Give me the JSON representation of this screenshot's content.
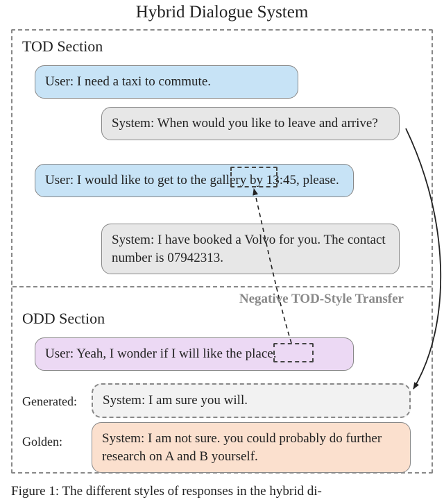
{
  "title": "Hybrid Dialogue System",
  "tod": {
    "label": "TOD Section",
    "user1": "User: I need a taxi to commute.",
    "sys1": "System: When would you like to leave and arrive?",
    "user2": "User: I would like to get to the gallery by 13:45, please.",
    "sys2": "System: I have booked a Volvo for you. The contact number is 07942313."
  },
  "transfer_label": "Negative TOD-Style Transfer",
  "odd": {
    "label": "ODD Section",
    "user1": "User: Yeah, I wonder if I will like the place.",
    "generated_label": "Generated:",
    "generated": "System: I am sure you will.",
    "golden_label": "Golden:",
    "golden": "System: I am not sure. you could probably do further research on A and B yourself."
  },
  "caption": "Figure 1: The different styles of responses in the hybrid di-"
}
